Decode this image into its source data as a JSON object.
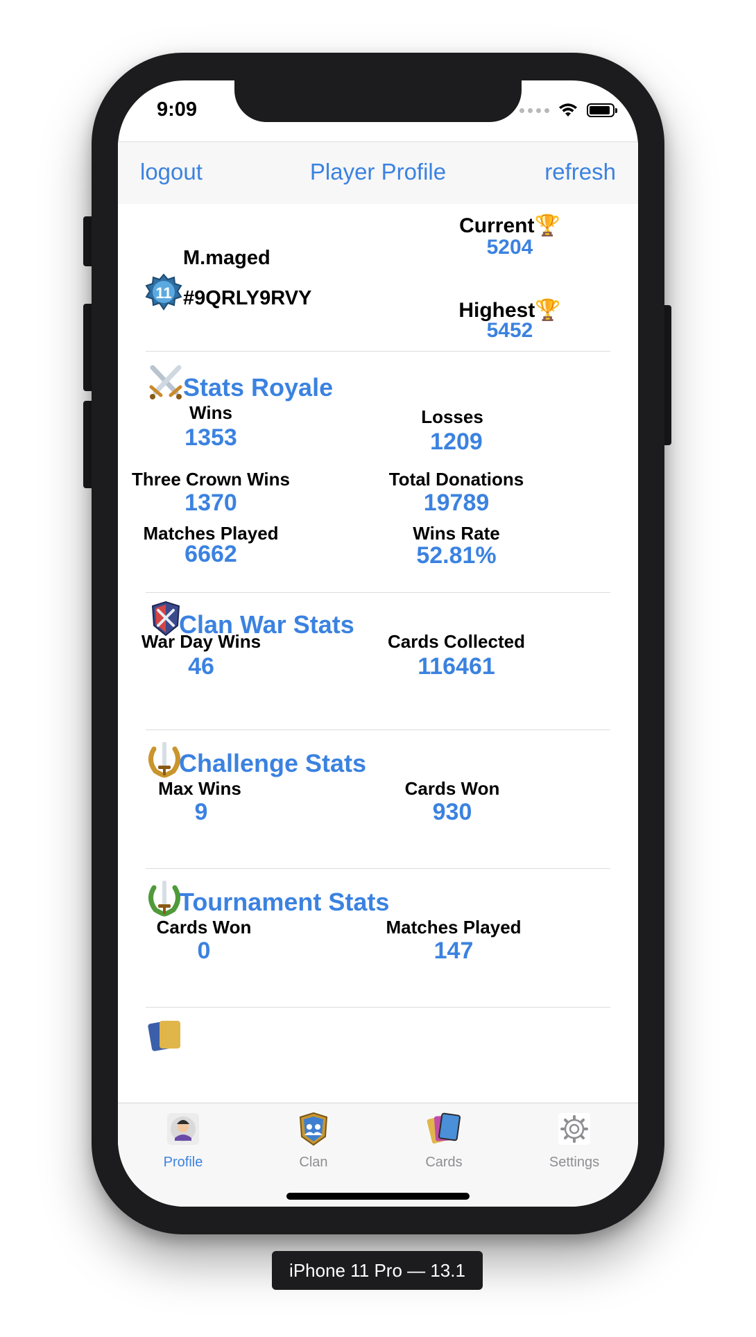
{
  "status_bar": {
    "time": "9:09"
  },
  "navbar": {
    "left_label": "logout",
    "title": "Player Profile",
    "right_label": "refresh"
  },
  "player": {
    "name": "M.maged",
    "tag": "#9QRLY9RVY",
    "level": "11",
    "current_label": "Current🏆",
    "current_value": "5204",
    "highest_label": "Highest🏆",
    "highest_value": "5452"
  },
  "sections": {
    "stats_royale": {
      "title": "Stats Royale",
      "icon": "crossed-swords-icon",
      "wins_label": "Wins",
      "wins_value": "1353",
      "losses_label": "Losses",
      "losses_value": "1209",
      "three_crown_label": "Three Crown Wins",
      "three_crown_value": "1370",
      "donations_label": "Total Donations",
      "donations_value": "19789",
      "matches_label": "Matches Played",
      "matches_value": "6662",
      "win_rate_label": "Wins Rate",
      "win_rate_value": "52.81%"
    },
    "clan_war": {
      "title": "Clan War Stats",
      "icon": "clan-war-shield-icon",
      "war_day_wins_label": "War Day Wins",
      "war_day_wins_value": "46",
      "cards_collected_label": "Cards Collected",
      "cards_collected_value": "116461"
    },
    "challenge": {
      "title": "Challenge Stats",
      "icon": "gold-laurel-sword-icon",
      "max_wins_label": "Max Wins",
      "max_wins_value": "9",
      "cards_won_label": "Cards Won",
      "cards_won_value": "930"
    },
    "tournament": {
      "title": "Tournament Stats",
      "icon": "green-laurel-sword-icon",
      "cards_won_label": "Cards Won",
      "cards_won_value": "0",
      "matches_label": "Matches Played",
      "matches_value": "147"
    }
  },
  "tabbar": {
    "items": [
      {
        "label": "Profile",
        "icon": "profile-avatar-icon",
        "active": true
      },
      {
        "label": "Clan",
        "icon": "clan-shield-icon",
        "active": false
      },
      {
        "label": "Cards",
        "icon": "cards-stack-icon",
        "active": false
      },
      {
        "label": "Settings",
        "icon": "gear-icon",
        "active": false
      }
    ]
  },
  "device_caption": "iPhone 11 Pro — 13.1",
  "colors": {
    "accent": "#3b82e0",
    "frame": "#1c1c1e",
    "bar_background": "#f7f7f7"
  },
  "battery_level": 0.9
}
